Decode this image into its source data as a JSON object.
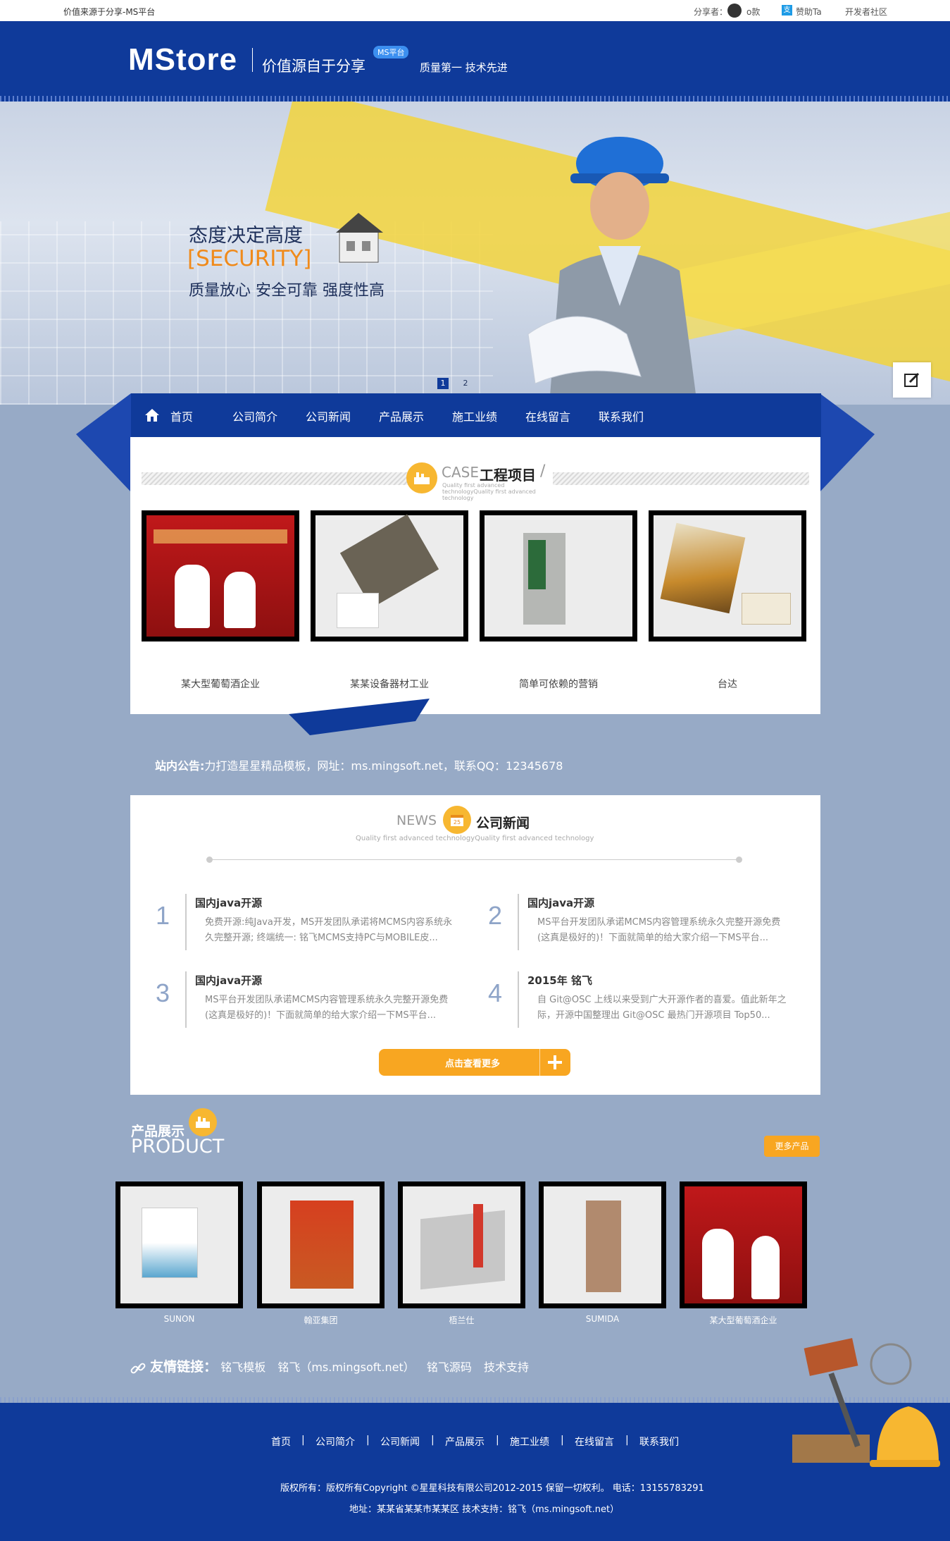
{
  "topbar": {
    "left_text": "价值来源于分享-MS平台",
    "sharer_label": "分享者：",
    "sharer_name": "o款",
    "sponsor": "赞助Ta",
    "community": "开发者社区"
  },
  "header": {
    "logo": "MStore",
    "slogan": "价值源自于分享",
    "badge": "MS平台",
    "tagline": "质量第一 技术先进"
  },
  "banner": {
    "line1": "态度决定高度",
    "line2": "[SECURITY]",
    "line3": "质量放心 安全可靠 强度性高",
    "dots": [
      "1",
      "2"
    ]
  },
  "nav": {
    "items": [
      "首页",
      "公司简介",
      "公司新闻",
      "产品展示",
      "施工业绩",
      "在线留言",
      "联系我们"
    ]
  },
  "case": {
    "en": "CASE",
    "title": "工程项目",
    "sub": "Quality first advanced technologyQuality first advanced technology",
    "items": [
      {
        "caption": "某大型葡萄酒企业"
      },
      {
        "caption": "某某设备器材工业"
      },
      {
        "caption": "简单可依赖的营销"
      },
      {
        "caption": "台达"
      }
    ]
  },
  "notice": {
    "label": "站内公告:",
    "text": "力打造星星精品模板，网址：ms.mingsoft.net，联系QQ：12345678"
  },
  "news": {
    "en": "NEWS",
    "title": "公司新闻",
    "sub": "Quality first advanced technologyQuality first advanced technology",
    "items": [
      {
        "num": "1",
        "title": "国内java开源",
        "body": "免费开源:纯Java开发，MS开发团队承诺将MCMS内容系统永久完整开源; 终端统一: 铭飞MCMS支持PC与MOBILE皮..."
      },
      {
        "num": "2",
        "title": "国内java开源",
        "body": "MS平台开发团队承诺MCMS内容管理系统永久完整开源免费(这真是极好的)！下面就简单的给大家介绍一下MS平台..."
      },
      {
        "num": "3",
        "title": "国内java开源",
        "body": "MS平台开发团队承诺MCMS内容管理系统永久完整开源免费(这真是极好的)！下面就简单的给大家介绍一下MS平台..."
      },
      {
        "num": "4",
        "title": "2015年 铭飞",
        "body": "自 Git@OSC 上线以来受到广大开源作者的喜爱。值此新年之际，开源中国整理出 Git@OSC 最热门开源项目 Top50..."
      }
    ],
    "more": "点击查看更多"
  },
  "product": {
    "cn": "产品展示",
    "en": "PRODUCT",
    "more": "更多产品",
    "items": [
      {
        "caption": "SUNON"
      },
      {
        "caption": "翰亚集团"
      },
      {
        "caption": "梧兰仕"
      },
      {
        "caption": "SUMIDA"
      },
      {
        "caption": "某大型葡萄酒企业"
      }
    ]
  },
  "links": {
    "label": "友情链接：",
    "items": [
      "铭飞模板",
      "铭飞（ms.mingsoft.net）",
      "铭飞源码",
      "技术支持"
    ]
  },
  "footer": {
    "nav": [
      "首页",
      "公司简介",
      "公司新闻",
      "产品展示",
      "施工业绩",
      "在线留言",
      "联系我们"
    ],
    "copyright": "版权所有：版权所有Copyright ©星星科技有限公司2012-2015 保留一切权利。   电话：13155783291",
    "address": "地址：某某省某某市某某区    技术支持：铭飞（ms.mingsoft.net）"
  }
}
